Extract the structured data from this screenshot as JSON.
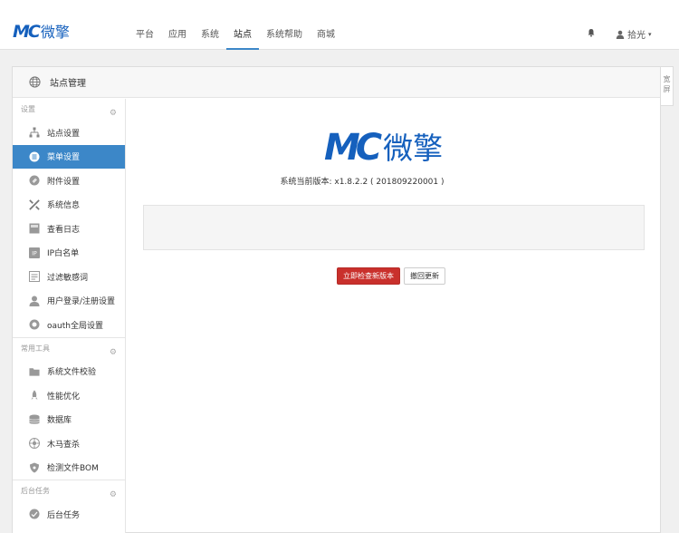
{
  "brand": {
    "logo_mark": "MC",
    "logo_text": "微擎",
    "accent_color": "#1560bd"
  },
  "nav": {
    "items": [
      {
        "label": "平台",
        "active": false
      },
      {
        "label": "应用",
        "active": false
      },
      {
        "label": "系统",
        "active": false
      },
      {
        "label": "站点",
        "active": true
      },
      {
        "label": "系统帮助",
        "active": false
      },
      {
        "label": "商城",
        "active": false
      }
    ],
    "bell_icon": "bell-icon",
    "user": {
      "name": "拾光",
      "icon": "user-icon",
      "caret": "▾"
    }
  },
  "panel": {
    "title": "站点管理",
    "title_icon": "globe-icon",
    "wide_label": "宽屏"
  },
  "sidebar": {
    "groups": [
      {
        "title": "设置",
        "items": [
          {
            "label": "站点设置",
            "icon": "sitemap-icon",
            "active": false
          },
          {
            "label": "菜单设置",
            "icon": "menu-icon",
            "active": true
          },
          {
            "label": "附件设置",
            "icon": "attachment-icon",
            "active": false
          },
          {
            "label": "系统信息",
            "icon": "tools-icon",
            "active": false
          },
          {
            "label": "查看日志",
            "icon": "log-icon",
            "active": false
          },
          {
            "label": "IP白名单",
            "icon": "ip-icon",
            "active": false
          },
          {
            "label": "过滤敏感词",
            "icon": "filter-icon",
            "active": false
          },
          {
            "label": "用户登录/注册设置",
            "icon": "user-icon",
            "active": false
          },
          {
            "label": "oauth全局设置",
            "icon": "oauth-icon",
            "active": false
          }
        ]
      },
      {
        "title": "常用工具",
        "items": [
          {
            "label": "系统文件校验",
            "icon": "folder-icon",
            "active": false
          },
          {
            "label": "性能优化",
            "icon": "rocket-icon",
            "active": false
          },
          {
            "label": "数据库",
            "icon": "database-icon",
            "active": false
          },
          {
            "label": "木马查杀",
            "icon": "virus-icon",
            "active": false
          },
          {
            "label": "检测文件BOM",
            "icon": "shield-icon",
            "active": false
          }
        ]
      },
      {
        "title": "后台任务",
        "items": [
          {
            "label": "后台任务",
            "icon": "task-icon",
            "active": false
          }
        ]
      }
    ]
  },
  "main": {
    "version_text": "系统当前版本: x1.8.2.2 ( 201809220001 )",
    "check_update_label": "立即检查新版本",
    "rollback_label": "撤回更新"
  }
}
